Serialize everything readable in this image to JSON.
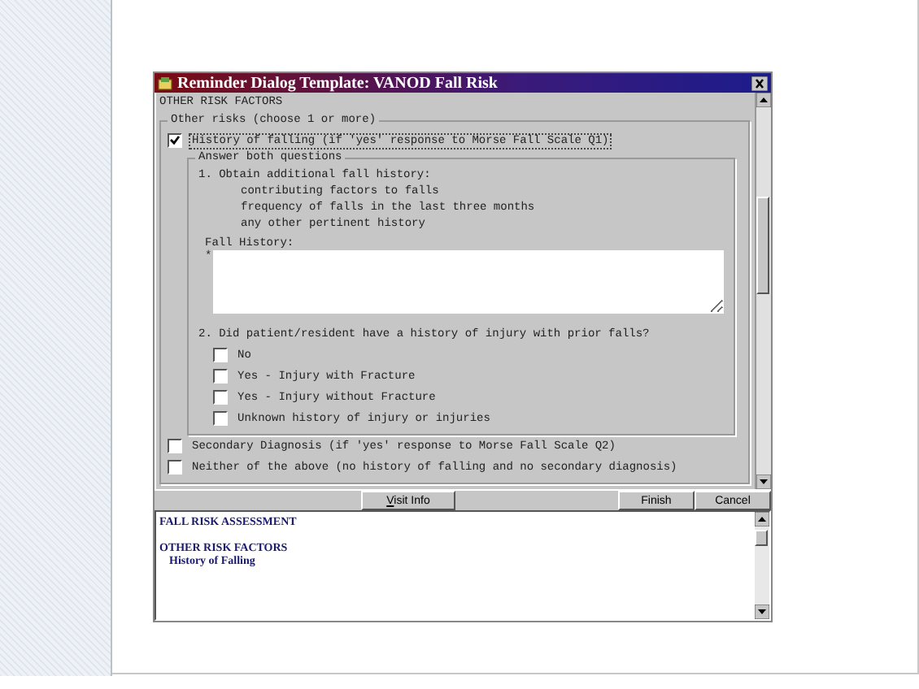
{
  "window": {
    "title": "Reminder Dialog Template: VANOD Fall Risk"
  },
  "form": {
    "header": "OTHER RISK FACTORS",
    "group_title": "Other risks (choose 1 or more)",
    "options": [
      {
        "label": "History of falling (if 'yes' response to Morse Fall Scale Q1)",
        "checked": true,
        "focused": true,
        "subgroup": {
          "title": "Answer both questions",
          "q1": {
            "text": "1. Obtain additional fall history:",
            "items": [
              "contributing factors to falls",
              "frequency of falls in the last three months",
              "any other pertinent history"
            ]
          },
          "field": {
            "label": "Fall History:",
            "required_mark": "*"
          },
          "q2": {
            "text": "2. Did patient/resident have a history of injury with prior falls?",
            "options": [
              {
                "label": "No",
                "checked": false
              },
              {
                "label": "Yes - Injury with Fracture",
                "checked": false
              },
              {
                "label": "Yes - Injury without Fracture",
                "checked": false
              },
              {
                "label": "Unknown history of injury or injuries",
                "checked": false
              }
            ]
          }
        }
      },
      {
        "label": "Secondary Diagnosis (if 'yes' response to Morse Fall Scale Q2)",
        "checked": false,
        "focused": false
      },
      {
        "label": "Neither of the above (no history of falling and no secondary diagnosis)",
        "checked": false,
        "focused": false
      }
    ]
  },
  "buttons": [
    {
      "label": "Visit Info",
      "kind": "left"
    },
    {
      "label": "Finish",
      "kind": "right"
    },
    {
      "label": "Cancel",
      "kind": "right"
    }
  ],
  "preview": [
    {
      "title": "FALL RISK ASSESSMENT"
    },
    {
      "title": "OTHER RISK FACTORS",
      "children": [
        {
          "title": "History of Falling"
        }
      ]
    }
  ]
}
